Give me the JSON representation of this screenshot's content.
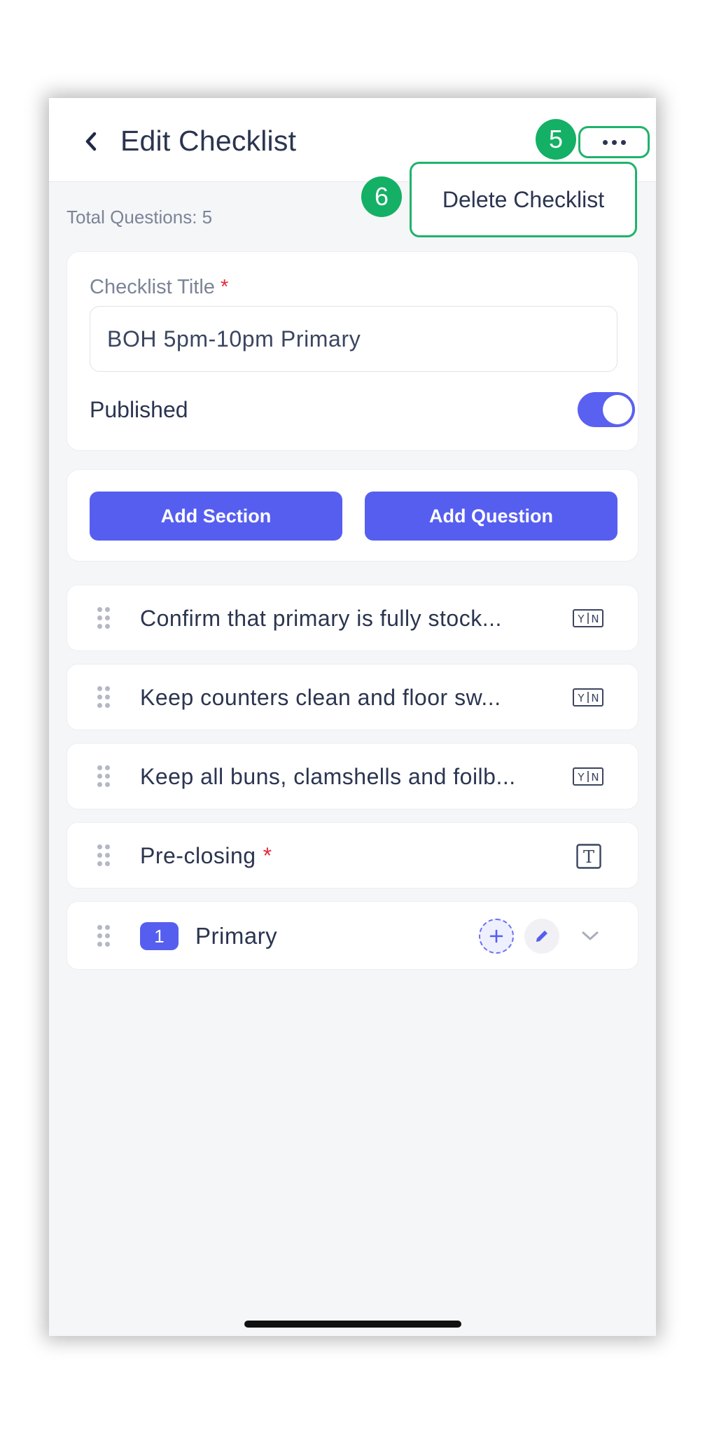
{
  "header": {
    "title": "Edit Checklist",
    "more_menu": {
      "step_badge": "5",
      "item_step_badge": "6",
      "items": [
        "Delete Checklist"
      ]
    }
  },
  "summary": {
    "total_questions": "Total Questions: 5"
  },
  "title_card": {
    "label": "Checklist Title",
    "required_mark": "*",
    "value": "BOH 5pm-10pm Primary",
    "published_label": "Published",
    "published": true
  },
  "actions": {
    "add_section": "Add Section",
    "add_question": "Add Question"
  },
  "questions": [
    {
      "text": "Confirm that primary is fully stock...",
      "type_icon": "yes-no-icon"
    },
    {
      "text": "Keep counters clean and floor sw...",
      "type_icon": "yes-no-icon"
    },
    {
      "text": "Keep all buns, clamshells and foilb...",
      "type_icon": "yes-no-icon"
    },
    {
      "text": "Pre-closing",
      "required_mark": "*",
      "type_icon": "text-icon"
    }
  ],
  "section": {
    "number": "1",
    "name": "Primary"
  },
  "colors": {
    "accent": "#565ef0",
    "highlight": "#1fb36a",
    "required": "#e02b3c"
  }
}
